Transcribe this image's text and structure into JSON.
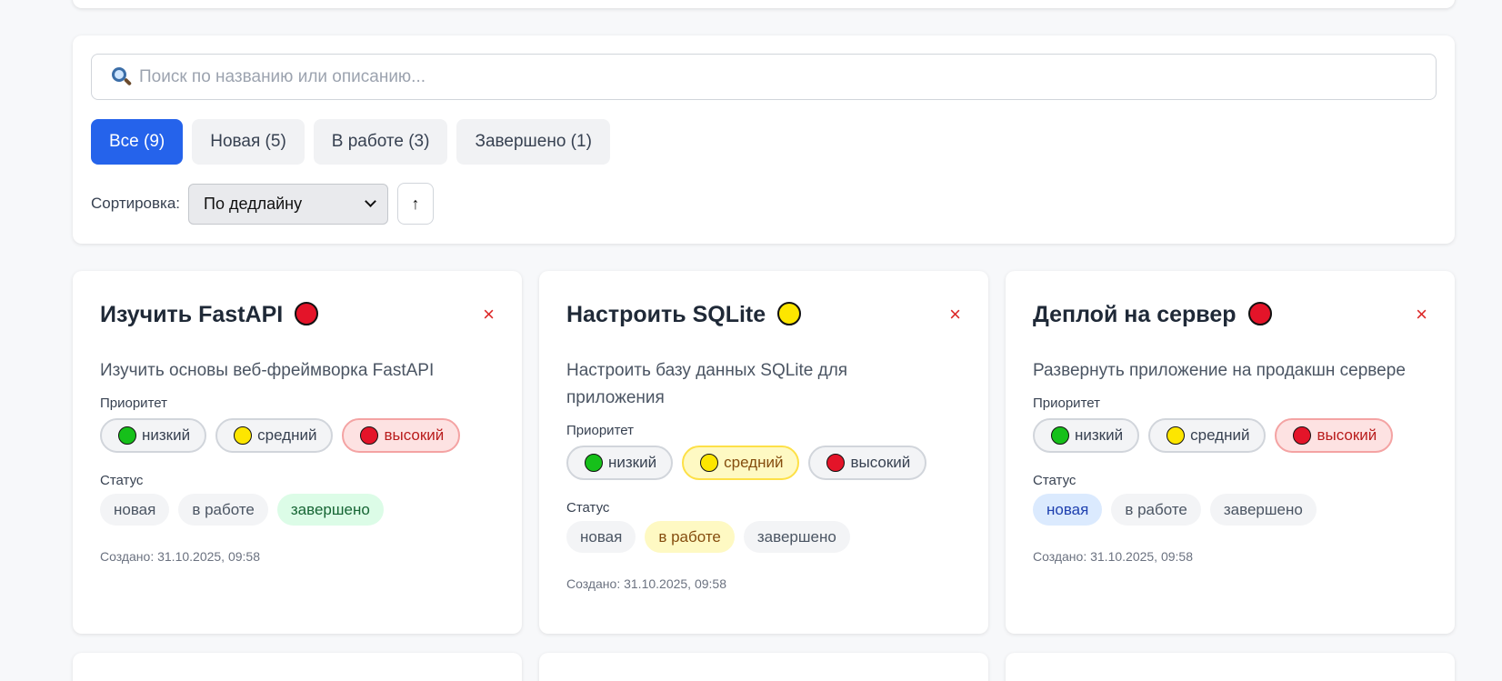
{
  "search": {
    "placeholder": "Поиск по названию или описанию..."
  },
  "tabs": [
    {
      "label": "Все (9)",
      "active": true
    },
    {
      "label": "Новая (5)",
      "active": false
    },
    {
      "label": "В работе (3)",
      "active": false
    },
    {
      "label": "Завершено (1)",
      "active": false
    }
  ],
  "sort": {
    "label": "Сортировка:",
    "selected": "По дедлайну",
    "direction": "↑"
  },
  "labels": {
    "priority": "Приоритет",
    "status": "Статус",
    "close": "×"
  },
  "priority_options": [
    "низкий",
    "средний",
    "высокий"
  ],
  "status_options": [
    "новая",
    "в работе",
    "завершено"
  ],
  "colors": {
    "low": "#16c01a",
    "medium": "#fde600",
    "high": "#e41429",
    "accent": "#2563eb"
  },
  "tasks": [
    {
      "title": "Изучить FastAPI",
      "priority": "high",
      "description": "Изучить основы веб-фреймворка FastAPI",
      "status": "завершено",
      "created": "Создано: 31.10.2025, 09:58"
    },
    {
      "title": "Настроить SQLite",
      "priority": "medium",
      "description": "Настроить базу данных SQLite для приложения",
      "status": "в работе",
      "created": "Создано: 31.10.2025, 09:58"
    },
    {
      "title": "Деплой на сервер",
      "priority": "high",
      "description": "Развернуть приложение на продакшн сервере",
      "status": "новая",
      "created": "Создано: 31.10.2025, 09:58"
    }
  ]
}
